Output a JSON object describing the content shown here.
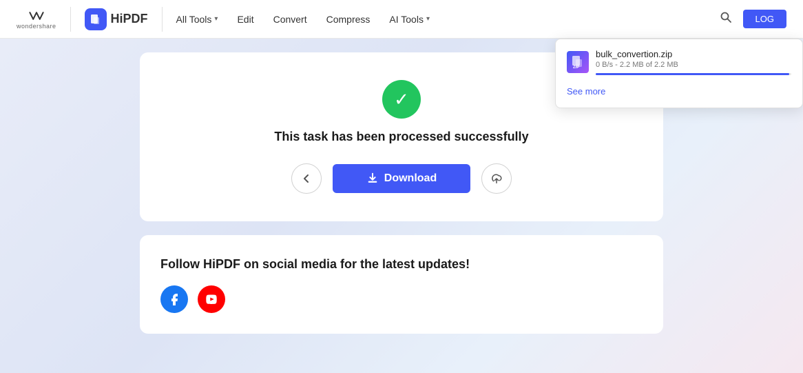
{
  "header": {
    "wondershare_text": "wondershare",
    "hipdf_label": "HiPDF",
    "nav": {
      "all_tools": "All Tools",
      "edit": "Edit",
      "convert": "Convert",
      "compress": "Compress",
      "ai_tools": "AI Tools",
      "login": "LOG"
    }
  },
  "main": {
    "success_icon": "✓",
    "success_message": "This task has been processed successfully",
    "download_button_label": "Download",
    "back_icon": "‹",
    "upload_icon": "↑"
  },
  "social": {
    "title": "Follow HiPDF on social media for the latest updates!",
    "facebook_icon": "f",
    "youtube_icon": "▶"
  },
  "popup": {
    "filename": "bulk_convertion.zip",
    "progress_text": "0 B/s - 2.2 MB of 2.2 MB",
    "progress_percent": 99,
    "see_more": "See more",
    "file_thumb_text": "ZIP"
  }
}
